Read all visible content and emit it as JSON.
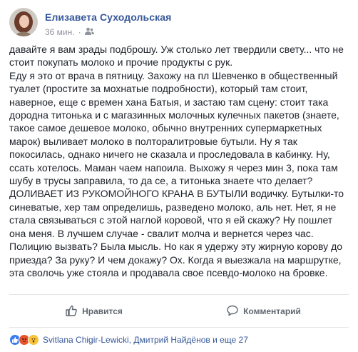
{
  "post": {
    "author": "Елизавета Суходольская",
    "time": "36 мин.",
    "dot": "·",
    "paragraphs": [
      "давайте я вам зрады подброшу. Уж столько лет твердили свету... что не стоит покупать молоко и прочие продукты с рук.",
      "Еду я это от врача в пятницу. Захожу на пл Шевченко в общественный туалет (простите за мохнатые подробности), который там стоит, наверное, еще с времен хана Батыя, и застаю там сцену: стоит така дородна титонька и с магазинных молочных кулечных пакетов (знаете, такое самое дешевое молоко, обычно внутренних супермаркетных марок) выливает молоко в полторалитровые бутыли. Ну я так покосилась, однако ничего не сказала и проследовала в кабинку. Ну, ссать хотелось. Маман чаем напоила. Выхожу я через мин 3, пока там шубу в трусы заправила, то да се, а титонька знаете что делает? ДОЛИВАЕТ ИЗ РУКОМОЙНОГО КРАНА В БУТЫЛИ водичку. Бутылки-то синеватые, хер там определишь, разведено молоко, аль нет. Нет, я не стала связываться с этой наглой коровой, что я ей скажу? Ну пошлет она меня. В лучшем случае - свалит молча и вернется через час. Полицию вызвать? Была мысль. Но как я удержу эту жирную корову до приезда? За руку? И чем докажу? Ох. Когда я выезжала на маршрутке, эта сволочь уже стояла и продавала свое псевдо-молоко на бровке."
    ]
  },
  "actions": {
    "like": "Нравится",
    "comment": "Комментарий"
  },
  "reactions": {
    "names": "Svitlana Chigir-Lewicki, Дмитрий Найдёнов и еще 27"
  },
  "icons": [
    "avatar",
    "friends-icon",
    "like-icon",
    "comment-icon",
    "like-reaction-icon",
    "angry-reaction-icon",
    "wow-reaction-icon"
  ],
  "colors": {
    "author": "#365899",
    "meta": "#90949c",
    "action": "#606770",
    "like_blue": "#3b7cf6",
    "angry": "#e8542b",
    "wow": "#f7c33b"
  }
}
